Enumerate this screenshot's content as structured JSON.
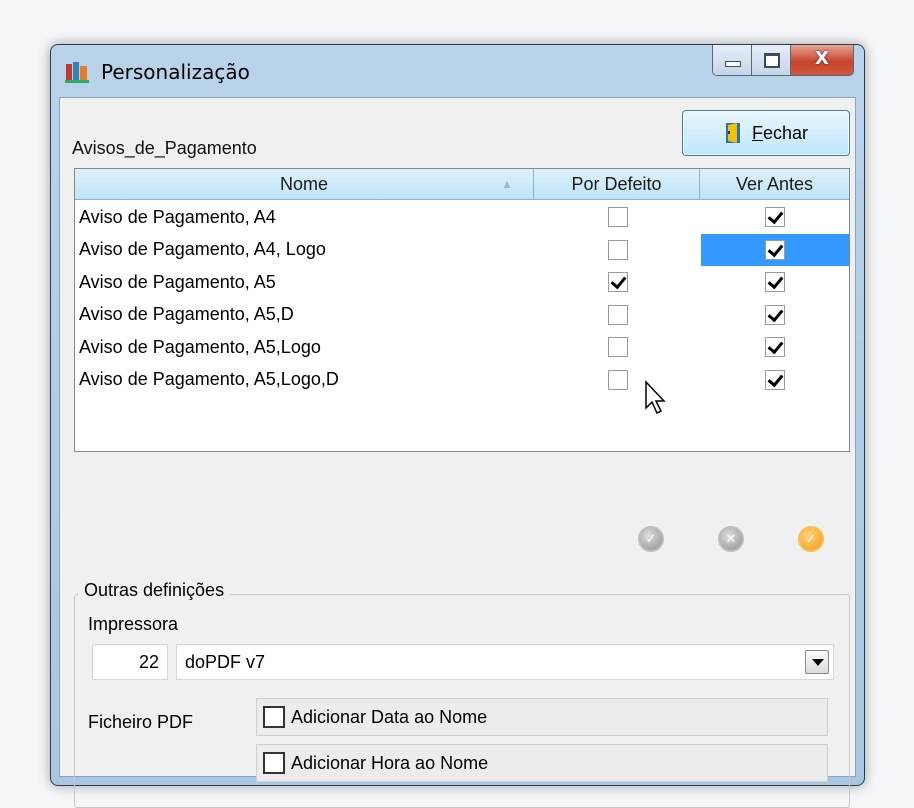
{
  "window": {
    "title": "Personalização",
    "minimize_icon": "minimize-icon",
    "maximize_icon": "maximize-icon",
    "close_glyph": "X"
  },
  "header": {
    "report_name": "Avisos_de_Pagamento",
    "close_button_first": "F",
    "close_button_rest": "echar"
  },
  "grid": {
    "columns": [
      "Nome",
      "Por Defeito",
      "Ver Antes"
    ],
    "sort_indicator": "▲",
    "rows": [
      {
        "name": "Aviso de Pagamento, A4",
        "por_defeito": false,
        "ver_antes": true,
        "selected": false
      },
      {
        "name": "Aviso de Pagamento, A4, Logo",
        "por_defeito": false,
        "ver_antes": true,
        "selected": true
      },
      {
        "name": "Aviso de Pagamento, A5",
        "por_defeito": true,
        "ver_antes": true,
        "selected": false
      },
      {
        "name": "Aviso de Pagamento, A5,D",
        "por_defeito": false,
        "ver_antes": true,
        "selected": false
      },
      {
        "name": "Aviso de Pagamento, A5,Logo",
        "por_defeito": false,
        "ver_antes": true,
        "selected": false
      },
      {
        "name": "Aviso de Pagamento, A5,Logo,D",
        "por_defeito": false,
        "ver_antes": true,
        "selected": false
      }
    ],
    "selection_color": "#3399ff",
    "header_color": "#bde4f8"
  },
  "actions": {
    "confirm_icon": "check-circle-icon",
    "cancel_icon": "x-circle-icon",
    "apply_icon": "apply-circle-icon"
  },
  "outras": {
    "title": "Outras definições",
    "impressora_label": "Impressora",
    "impressora_number": "22",
    "impressora_value": "doPDF v7",
    "ficheiro_label": "Ficheiro PDF",
    "option_data": "Adicionar Data ao Nome",
    "option_hora": "Adicionar Hora ao Nome",
    "option_data_checked": false,
    "option_hora_checked": false
  },
  "colors": {
    "window_frame": "#a9c6e2",
    "close_button": "#c6452c",
    "apply_accent": "#f39a12"
  }
}
